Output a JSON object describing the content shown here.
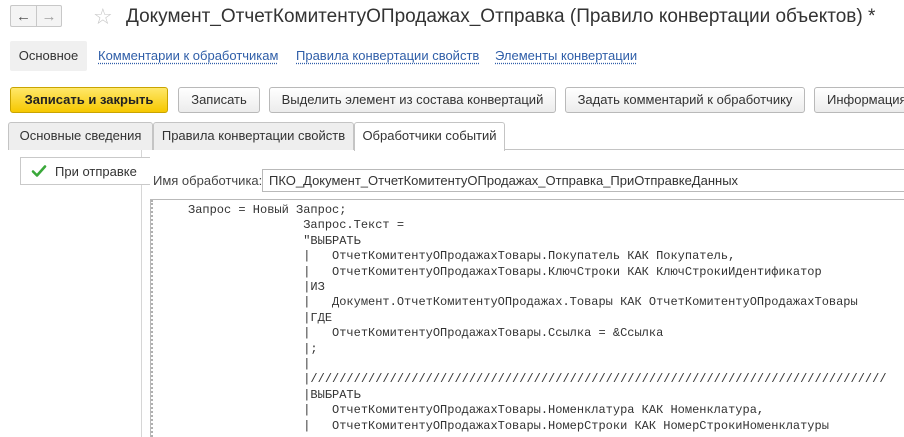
{
  "window": {
    "title": "Документ_ОтчетКомитентуОПродажах_Отправка (Правило конвертации объектов) *",
    "back_glyph": "←",
    "forward_glyph": "→",
    "favorite_glyph": "☆"
  },
  "panel_nav": {
    "items": [
      {
        "label": "Основное",
        "active": true
      },
      {
        "label": "Комментарии к обработчикам",
        "active": false
      },
      {
        "label": "Правила конвертации свойств",
        "active": false
      },
      {
        "label": "Элементы конвертации",
        "active": false
      }
    ]
  },
  "command_bar": {
    "buttons": [
      {
        "label": "Записать и закрыть",
        "primary": true
      },
      {
        "label": "Записать"
      },
      {
        "label": "Выделить элемент из состава конвертаций"
      },
      {
        "label": "Задать комментарий к обработчику"
      },
      {
        "label": "Информация"
      }
    ]
  },
  "tabs": {
    "items": [
      {
        "label": "Основные сведения"
      },
      {
        "label": "Правила конвертации свойств"
      },
      {
        "label": "Обработчики событий",
        "active": true
      }
    ]
  },
  "events": {
    "items": [
      {
        "label": "При отправке",
        "icon": "check-icon",
        "selected": true
      }
    ]
  },
  "handler": {
    "label": "Имя обработчика:",
    "value": "ПКО_Документ_ОтчетКомитентуОПродажах_Отправка_ПриОтправкеДанных"
  },
  "code_editor": {
    "text": "Запрос = Новый Запрос;\n                Запрос.Текст =\n                \"ВЫБРАТЬ\n                |   ОтчетКомитентуОПродажахТовары.Покупатель КАК Покупатель,\n                |   ОтчетКомитентуОПродажахТовары.КлючСтроки КАК КлючСтрокиИдентификатор\n                |ИЗ\n                |   Документ.ОтчетКомитентуОПродажах.Товары КАК ОтчетКомитентуОПродажахТовары\n                |ГДЕ\n                |   ОтчетКомитентуОПродажахТовары.Ссылка = &Ссылка\n                |;\n                |\n                |////////////////////////////////////////////////////////////////////////////////\n                |ВЫБРАТЬ\n                |   ОтчетКомитентуОПродажахТовары.Номенклатура КАК Номенклатура,\n                |   ОтчетКомитентуОПродажахТовары.НомерСтроки КАК НомерСтрокиНоменклатуры"
  },
  "colors": {
    "primary_button": "#f6c800",
    "link": "#2f5ea8",
    "check": "#3aa83a"
  }
}
